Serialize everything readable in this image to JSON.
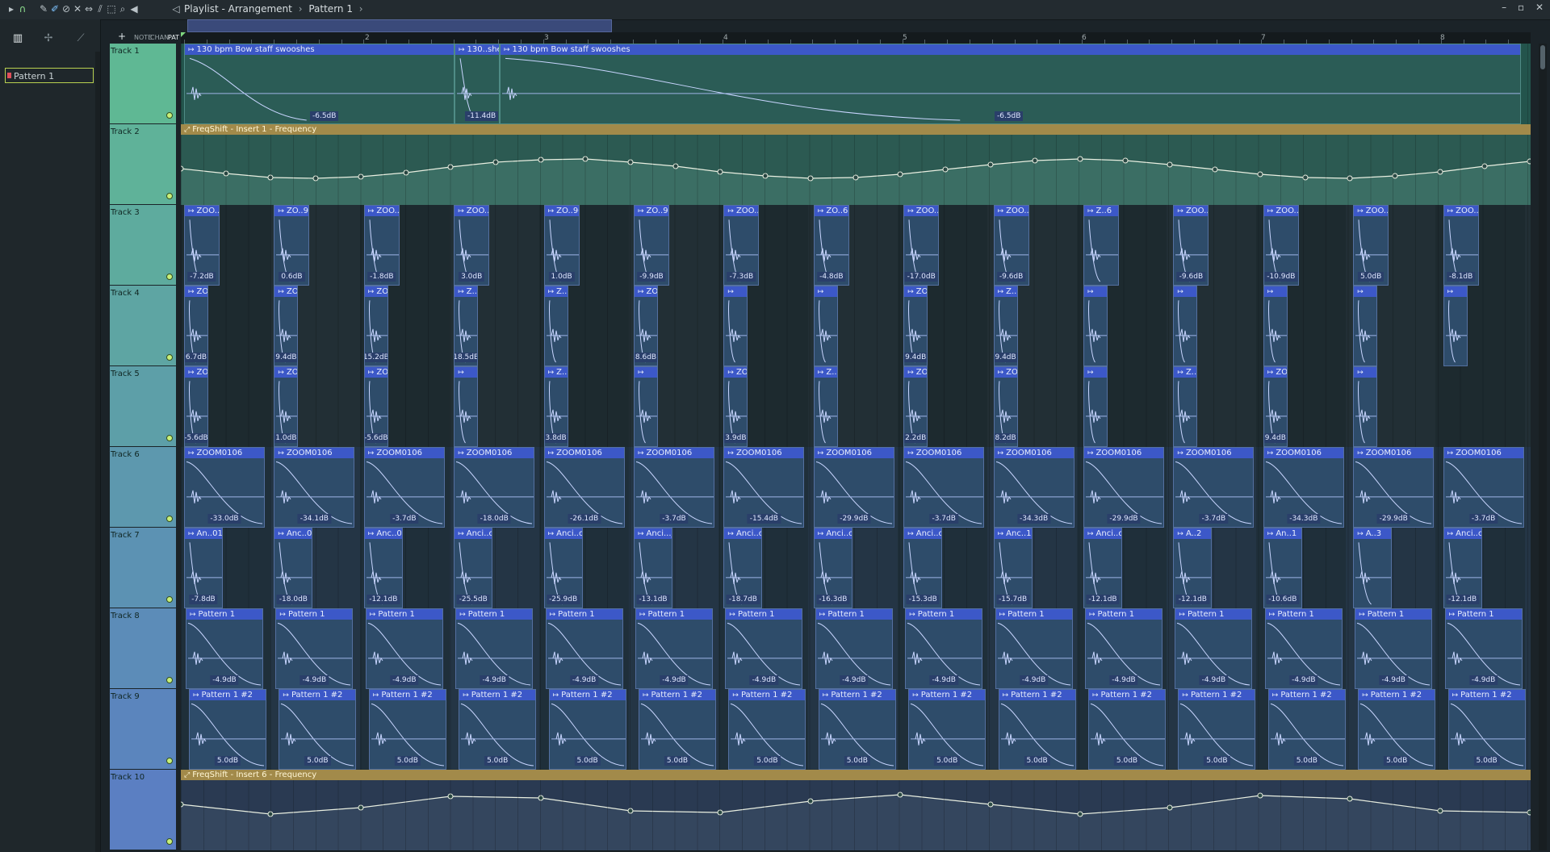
{
  "title": {
    "app": "Playlist",
    "view": "Arrangement",
    "pattern": "Pattern 1",
    "separator": "›",
    "dash": "-"
  },
  "picker": {
    "tabs": [
      "piano-roll-tab",
      "note-tab",
      "line-tab"
    ],
    "items": [
      "Pattern 1"
    ]
  },
  "header_tools": {
    "add": "+",
    "note": "NOTE",
    "chan": "CHAN",
    "pat": "PAT"
  },
  "ruler": {
    "bars": [
      "2",
      "3",
      "4",
      "5",
      "6",
      "7",
      "8"
    ]
  },
  "tracks": [
    {
      "name": "Track 1"
    },
    {
      "name": "Track 2"
    },
    {
      "name": "Track 3"
    },
    {
      "name": "Track 4"
    },
    {
      "name": "Track 5"
    },
    {
      "name": "Track 6"
    },
    {
      "name": "Track 7"
    },
    {
      "name": "Track 8"
    },
    {
      "name": "Track 9"
    },
    {
      "name": "Track 10"
    }
  ],
  "clips": {
    "track1": [
      {
        "title": "130 bpm Bow staff swooshes",
        "vols": [
          "-6.5dB",
          "-11.4dB"
        ]
      },
      {
        "title": "130..shes",
        "vols": []
      },
      {
        "title": "130 bpm Bow staff swooshes",
        "vols": [
          "-6.5dB"
        ]
      }
    ],
    "track2_automation": "FreqShift - Insert 1 - Frequency",
    "track3": [
      {
        "t": "ZOO..96",
        "v": "-7.2dB"
      },
      {
        "t": "ZO..96",
        "v": "0.6dB"
      },
      {
        "t": "ZOO..96",
        "v": "-1.8dB"
      },
      {
        "t": "ZOO..96",
        "v": "3.0dB"
      },
      {
        "t": "ZO..96",
        "v": "1.0dB"
      },
      {
        "t": "ZO..96",
        "v": "-9.9dB"
      },
      {
        "t": "ZOO..96",
        "v": "-7.3dB"
      },
      {
        "t": "ZO..6",
        "v": "-4.8dB"
      },
      {
        "t": "ZOO..096",
        "v": "-17.0dB"
      },
      {
        "t": "ZOO..96",
        "v": "-9.6dB"
      },
      {
        "t": "Z..6",
        "v": ""
      },
      {
        "t": "ZOO..096",
        "v": "-9.6dB"
      },
      {
        "t": "ZOO..96",
        "v": "-10.9dB"
      },
      {
        "t": "ZOO..96",
        "v": "5.0dB"
      },
      {
        "t": "ZOO..96",
        "v": "-8.1dB"
      }
    ],
    "track4": [
      {
        "t": "ZO..5",
        "v": "6.7dB"
      },
      {
        "t": "ZO..05",
        "v": "9.4dB"
      },
      {
        "t": "ZO..05",
        "v": "15.2dB"
      },
      {
        "t": "Z..5",
        "v": "18.5dB"
      },
      {
        "t": "Z..5",
        "v": ""
      },
      {
        "t": "ZO..5",
        "v": "8.6dB"
      },
      {
        "t": "",
        "v": ""
      },
      {
        "t": "",
        "v": ""
      },
      {
        "t": "ZO..5",
        "v": "9.4dB"
      },
      {
        "t": "Z..5",
        "v": "9.4dB"
      },
      {
        "t": "",
        "v": ""
      },
      {
        "t": "",
        "v": ""
      },
      {
        "t": "",
        "v": ""
      },
      {
        "t": "",
        "v": ""
      },
      {
        "t": "",
        "v": ""
      }
    ],
    "track5": [
      {
        "t": "ZO..7",
        "v": "-5.6dB"
      },
      {
        "t": "ZOO..07",
        "v": "1.0dB"
      },
      {
        "t": "ZOO..07",
        "v": "-5.6dB"
      },
      {
        "t": "",
        "v": ""
      },
      {
        "t": "Z..7",
        "v": "3.8dB"
      },
      {
        "t": "",
        "v": ""
      },
      {
        "t": "ZO..7",
        "v": "3.9dB"
      },
      {
        "t": "Z..7",
        "v": ""
      },
      {
        "t": "ZOO..07",
        "v": "2.2dB"
      },
      {
        "t": "ZO..7",
        "v": "8.2dB"
      },
      {
        "t": "",
        "v": ""
      },
      {
        "t": "Z..7",
        "v": ""
      },
      {
        "t": "ZO..7",
        "v": "9.4dB"
      },
      {
        "t": "",
        "v": ""
      }
    ],
    "track6": [
      {
        "t": "ZOOM0106",
        "v": "-33.0dB"
      },
      {
        "t": "ZOOM0106",
        "v": "-34.1dB"
      },
      {
        "t": "ZOOM0106",
        "v": "-3.7dB"
      },
      {
        "t": "ZOOM0106",
        "v": "-18.0dB"
      },
      {
        "t": "ZOOM0106",
        "v": "-26.1dB"
      },
      {
        "t": "ZOOM0106",
        "v": "-3.7dB"
      },
      {
        "t": "ZOOM0106",
        "v": "-15.4dB"
      },
      {
        "t": "ZOOM0106",
        "v": "-29.9dB"
      },
      {
        "t": "ZOOM0106",
        "v": "-3.7dB"
      },
      {
        "t": "ZOOM0106",
        "v": "-34.3dB"
      },
      {
        "t": "ZOOM0106",
        "v": "-29.9dB"
      },
      {
        "t": "ZOOM0106",
        "v": "-3.7dB"
      },
      {
        "t": "ZOOM0106",
        "v": "-34.3dB"
      },
      {
        "t": "ZOOM0106",
        "v": "-29.9dB"
      },
      {
        "t": "ZOOM0106",
        "v": "-3.7dB"
      }
    ],
    "track7": [
      {
        "t": "An..01",
        "v": "-7.8dB"
      },
      {
        "t": "Anc..02",
        "v": "-18.0dB"
      },
      {
        "t": "Anc..03",
        "v": "-12.1dB"
      },
      {
        "t": "Anci..o_04",
        "v": "-25.5dB"
      },
      {
        "t": "Anci..o_05",
        "v": "-25.9dB"
      },
      {
        "t": "Anci..._06",
        "v": "-13.1dB"
      },
      {
        "t": "Anci..o_07",
        "v": "-18.7dB"
      },
      {
        "t": "Anci..o_08",
        "v": "-16.3dB"
      },
      {
        "t": "Anci..o_09",
        "v": "-15.3dB"
      },
      {
        "t": "Anc..10",
        "v": "-15.7dB"
      },
      {
        "t": "Anci..o_11",
        "v": "-12.1dB"
      },
      {
        "t": "A..2",
        "v": "-12.1dB"
      },
      {
        "t": "An..1",
        "v": "-10.6dB"
      },
      {
        "t": "A..3",
        "v": ""
      },
      {
        "t": "Anci..o_04",
        "v": "-12.1dB"
      }
    ],
    "track8": {
      "t": "Pattern 1",
      "v": "-4.9dB"
    },
    "track9": {
      "t": "Pattern 1 #2",
      "v": "5.0dB"
    },
    "track10_automation": "FreqShift - Insert 6 - Frequency"
  },
  "colors": {
    "accent": "#3c58c8",
    "automation": "#a28a4a",
    "header_top": "#5fb894",
    "header_bottom": "#5b7fc2"
  }
}
